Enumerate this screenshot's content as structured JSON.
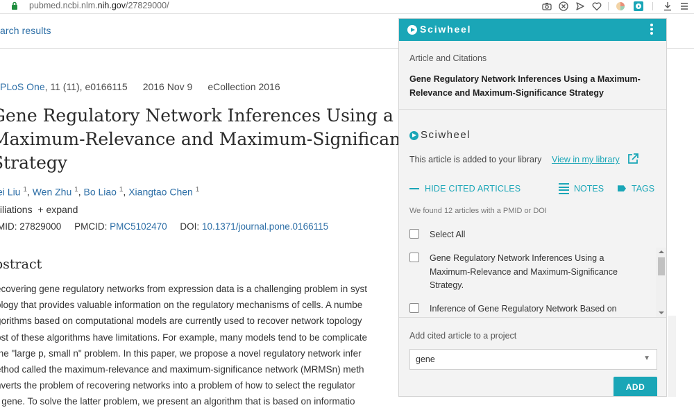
{
  "browser": {
    "url_prefix": "pubmed.ncbi.nlm.",
    "url_domain": "nih.gov",
    "url_path": "/27829000/",
    "icons": [
      "lock-icon",
      "camera-icon",
      "block-icon",
      "send-icon",
      "heart-icon",
      "extension-icon",
      "sciwheel-extension-icon",
      "download-icon",
      "menu-icon"
    ]
  },
  "page": {
    "search_results_link": "arch results",
    "citation": {
      "journal": "PLoS One",
      "volume_issue": ", 11 (11), e0166115",
      "date": "2016 Nov 9",
      "ecollection": "eCollection 2016"
    },
    "title_lines": [
      "Gene Regulatory Network Inferences Using a",
      "Maximum-Relevance and Maximum-Significan",
      "Strategy"
    ],
    "authors": [
      {
        "name": "ei Liu",
        "sup": "1",
        "sep": ", "
      },
      {
        "name": "Wen Zhu",
        "sup": "1",
        "sep": ", "
      },
      {
        "name": "Bo Liao",
        "sup": "1",
        "sep": ", "
      },
      {
        "name": "Xiangtao Chen",
        "sup": "1",
        "sep": ""
      }
    ],
    "affiliations": "filiations",
    "expand": "+ expand",
    "pmid_label": "MID: 27829000",
    "pmcid_label": "PMCID: ",
    "pmcid_value": "PMC5102470",
    "doi_label": "DOI: ",
    "doi_value": "10.1371/journal.pone.0166115",
    "abstract_heading": "bstract",
    "abstract_lines": [
      "ecovering gene regulatory networks from expression data is a challenging problem in syst",
      "ology that provides valuable information on the regulatory mechanisms of cells. A numbe",
      "gorithms based on computational models are currently used to recover network topology",
      "ost of these algorithms have limitations. For example, many models tend to be complicate",
      "the \"large p, small n\" problem. In this paper, we propose a novel regulatory network infer",
      "ethod called the maximum-relevance and maximum-significance network (MRMSn) meth",
      "nverts the problem of recovering networks into a problem of how to select the regulator",
      "r gene. To solve the latter problem, we present an algorithm that is based on informatio"
    ]
  },
  "sciwheel": {
    "brand": "Sciwheel",
    "section_label": "Article and Citations",
    "article_title": "Gene Regulatory Network Inferences Using a Maximum-Relevance and Maximum-Significance Strategy",
    "added_text": "This article is added to your library",
    "view_link": "View in my library",
    "hide_cited": "HIDE CITED ARTICLES",
    "notes": "NOTES",
    "tags": "TAGS",
    "found_text": "We found 12 articles with a PMID or DOI",
    "select_all": "Select All",
    "cited_articles": [
      "Gene Regulatory Network Inferences Using a Maximum-Relevance and Maximum-Significance Strategy.",
      "Inference of Gene Regulatory Network Based on Local Bayesian Networks."
    ],
    "project_label": "Add cited article to a project",
    "project_value": "gene",
    "add_button": "ADD",
    "accent_color": "#1aa6b7"
  }
}
